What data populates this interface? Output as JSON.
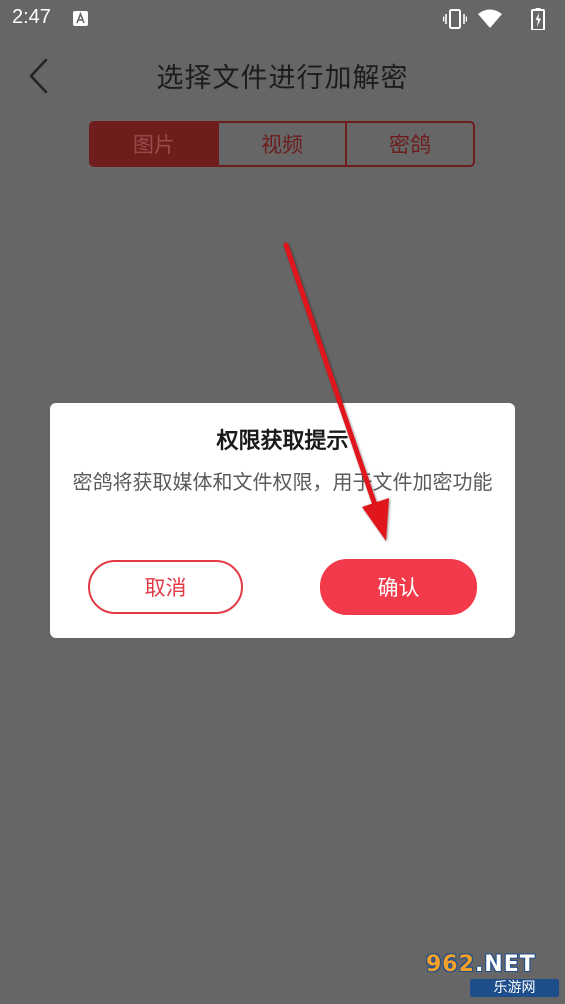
{
  "status_bar": {
    "time": "2:47",
    "icons": [
      "a-notification-icon",
      "vibrate-icon",
      "wifi-icon",
      "battery-icon"
    ]
  },
  "header": {
    "back_icon": "chevron-left-icon",
    "title": "选择文件进行加解密"
  },
  "tabs": [
    {
      "label": "图片",
      "active": true
    },
    {
      "label": "视频",
      "active": false
    },
    {
      "label": "密鸽",
      "active": false
    }
  ],
  "dialog": {
    "title": "权限获取提示",
    "message": "密鸽将获取媒体和文件权限，用于文件加密功能",
    "cancel_label": "取消",
    "confirm_label": "确认"
  },
  "watermark": {
    "top_prefix": "962",
    "top_suffix": ".NET",
    "bottom": "乐游网"
  },
  "colors": {
    "overlay_bg": "#666666",
    "accent": "#f23a4a",
    "tab_border": "#6e1c1c",
    "arrow": "#e0121e"
  }
}
